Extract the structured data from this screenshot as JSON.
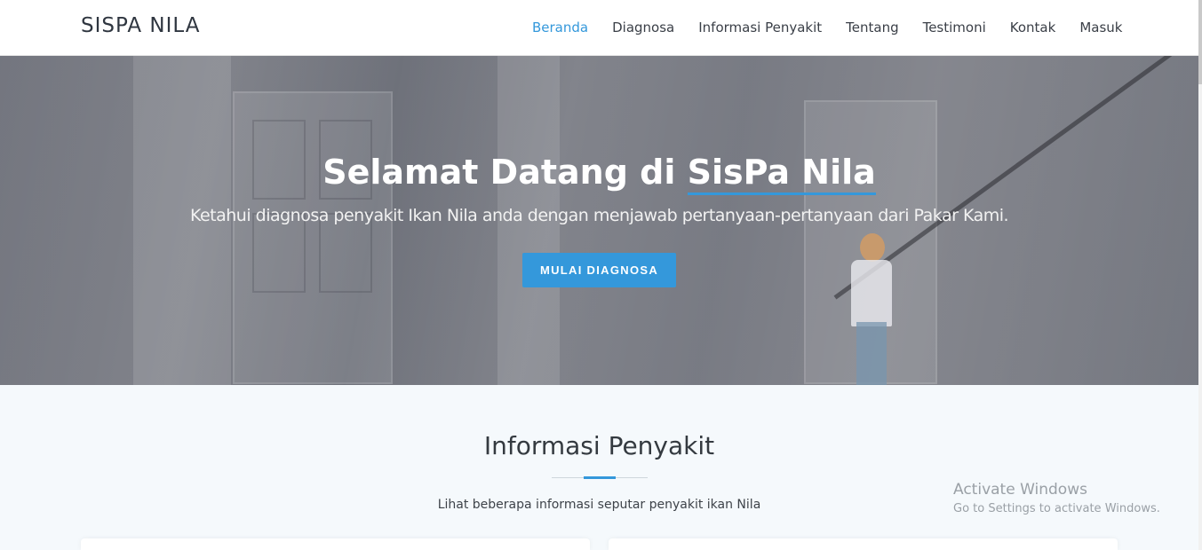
{
  "header": {
    "brand": "SISPA NILA",
    "nav": [
      {
        "label": "Beranda",
        "active": true
      },
      {
        "label": "Diagnosa"
      },
      {
        "label": "Informasi Penyakit"
      },
      {
        "label": "Tentang"
      },
      {
        "label": "Testimoni"
      },
      {
        "label": "Kontak"
      },
      {
        "label": "Masuk"
      }
    ]
  },
  "hero": {
    "title_prefix": "Selamat Datang di ",
    "title_highlight": "SisPa Nila",
    "subtitle": "Ketahui diagnosa penyakit Ikan Nila anda dengan menjawab pertanyaan-pertanyaan dari Pakar Kami.",
    "cta_label": "MULAI DIAGNOSA"
  },
  "section": {
    "title": "Informasi Penyakit",
    "description": "Lihat beberapa informasi seputar penyakit ikan Nila"
  },
  "watermark": {
    "line1": "Activate Windows",
    "line2": "Go to Settings to activate Windows."
  },
  "colors": {
    "accent": "#3498db",
    "nav_text": "#3a3f47",
    "section_bg": "#f5f9fc"
  }
}
